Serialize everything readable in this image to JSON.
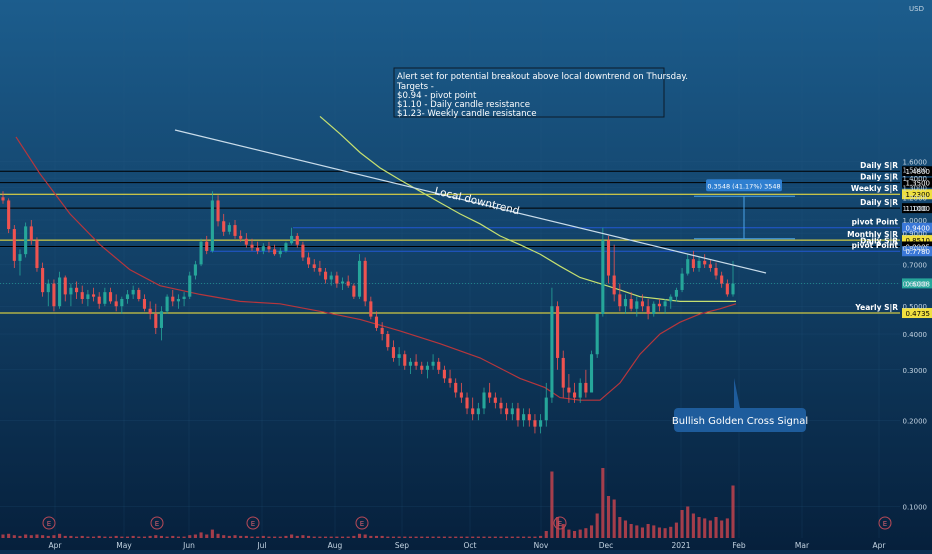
{
  "colors": {
    "bg_top": "#1c5d8d",
    "bg_bottom": "#06203c",
    "up": "#26a69a",
    "down": "#ef5350",
    "yellow_line": "#ffeb3b",
    "black_line": "#000000",
    "blue_line": "#2962ff",
    "ma_green": "#c6e070",
    "ma_red": "#b7363c",
    "trendline": "#c9dcea",
    "axis_text": "#c4d4e2",
    "volume": "#d9474f",
    "callout_bg": "#1e5c9c"
  },
  "chart_data": {
    "type": "candlestick",
    "currency": "USD",
    "y_axis": {
      "scale": "log",
      "ylim": [
        0.073,
        2.15
      ],
      "ticks": [
        "1.6000",
        "1.5000",
        "1.4000",
        "1.3000",
        "1.2000",
        "1.1000",
        "1.0000",
        "0.9000",
        "0.8000",
        "0.7000",
        "0.6000",
        "0.5000",
        "0.4000",
        "0.3000",
        "0.2000",
        "0.1000"
      ]
    },
    "x_axis": {
      "labels": [
        "Apr",
        "May",
        "Jun",
        "Jul",
        "Aug",
        "Sep",
        "Oct",
        "Nov",
        "Dec",
        "2021",
        "Feb",
        "Mar",
        "Apr"
      ]
    },
    "annotation_box": {
      "lines": [
        "Alert set for potential breakout above local downtrend on Thursday.",
        "Targets -",
        "$0.94 - pivot point",
        "$1.10 - Daily candle resistance",
        "$1.23- Weekly candle resistance"
      ]
    },
    "horizontal_levels": [
      {
        "label": "Daily S|R",
        "price": "1.4800",
        "value": 1.48,
        "style": "black"
      },
      {
        "label": "Daily S|R",
        "price": "1.3500",
        "value": 1.35,
        "style": "black"
      },
      {
        "label": "Weekly S|R",
        "price": "1.2300",
        "value": 1.23,
        "style": "yellow"
      },
      {
        "label": "Daily S|R",
        "price": "1.1000",
        "value": 1.1,
        "style": "black"
      },
      {
        "label": "pivot Point",
        "price": "0.9400",
        "value": 0.94,
        "style": "blue"
      },
      {
        "label": "Monthly S|R",
        "price": "0.8510",
        "value": 0.851,
        "style": "yellow"
      },
      {
        "label": "Daily S|R",
        "price": "0.8085",
        "value": 0.8085,
        "style": "black"
      },
      {
        "label": "pivot Point",
        "price": "0.7780",
        "value": 0.778,
        "style": "blue"
      },
      {
        "label": "Yearly S|R",
        "price": "0.4735",
        "value": 0.4735,
        "style": "yellow"
      }
    ],
    "current_price": {
      "price": "0.6008",
      "value": 0.6008
    },
    "trendline_label": "Local downtrend",
    "measure_label": "0.3548 (41.17%) 3548",
    "signal_label": "Bullish Golden Cross Signal",
    "earnings_marker": "E",
    "candles": [
      [
        1.2,
        1.26,
        1.14,
        1.17
      ],
      [
        1.17,
        1.19,
        0.9,
        0.93
      ],
      [
        0.93,
        0.96,
        0.68,
        0.72
      ],
      [
        0.72,
        0.79,
        0.64,
        0.76
      ],
      [
        0.76,
        0.98,
        0.74,
        0.95
      ],
      [
        0.95,
        1.0,
        0.82,
        0.85
      ],
      [
        0.85,
        0.87,
        0.66,
        0.68
      ],
      [
        0.68,
        0.71,
        0.54,
        0.56
      ],
      [
        0.56,
        0.62,
        0.5,
        0.6
      ],
      [
        0.6,
        0.62,
        0.48,
        0.5
      ],
      [
        0.5,
        0.66,
        0.49,
        0.63
      ],
      [
        0.63,
        0.64,
        0.52,
        0.55
      ],
      [
        0.55,
        0.6,
        0.5,
        0.58
      ],
      [
        0.58,
        0.61,
        0.53,
        0.56
      ],
      [
        0.56,
        0.59,
        0.51,
        0.53
      ],
      [
        0.53,
        0.57,
        0.5,
        0.55
      ],
      [
        0.55,
        0.58,
        0.52,
        0.54
      ],
      [
        0.54,
        0.56,
        0.49,
        0.51
      ],
      [
        0.51,
        0.58,
        0.5,
        0.56
      ],
      [
        0.56,
        0.58,
        0.51,
        0.52
      ],
      [
        0.52,
        0.55,
        0.48,
        0.5
      ],
      [
        0.5,
        0.54,
        0.47,
        0.53
      ],
      [
        0.53,
        0.57,
        0.51,
        0.55
      ],
      [
        0.55,
        0.59,
        0.53,
        0.57
      ],
      [
        0.57,
        0.58,
        0.52,
        0.53
      ],
      [
        0.53,
        0.55,
        0.48,
        0.49
      ],
      [
        0.49,
        0.52,
        0.45,
        0.47
      ],
      [
        0.47,
        0.51,
        0.4,
        0.42
      ],
      [
        0.42,
        0.5,
        0.38,
        0.48
      ],
      [
        0.48,
        0.55,
        0.47,
        0.54
      ],
      [
        0.54,
        0.57,
        0.5,
        0.52
      ],
      [
        0.52,
        0.55,
        0.49,
        0.53
      ],
      [
        0.53,
        0.56,
        0.5,
        0.54
      ],
      [
        0.54,
        0.66,
        0.53,
        0.64
      ],
      [
        0.64,
        0.72,
        0.62,
        0.7
      ],
      [
        0.7,
        0.86,
        0.69,
        0.84
      ],
      [
        0.84,
        0.88,
        0.76,
        0.78
      ],
      [
        0.78,
        1.26,
        0.77,
        1.17
      ],
      [
        1.17,
        1.22,
        0.95,
        0.99
      ],
      [
        0.99,
        1.05,
        0.88,
        0.91
      ],
      [
        0.91,
        0.98,
        0.89,
        0.96
      ],
      [
        0.96,
        1.0,
        0.86,
        0.88
      ],
      [
        0.88,
        0.92,
        0.84,
        0.86
      ],
      [
        0.86,
        0.9,
        0.8,
        0.82
      ],
      [
        0.82,
        0.86,
        0.78,
        0.8
      ],
      [
        0.8,
        0.84,
        0.76,
        0.78
      ],
      [
        0.78,
        0.83,
        0.76,
        0.81
      ],
      [
        0.81,
        0.84,
        0.77,
        0.79
      ],
      [
        0.79,
        0.82,
        0.75,
        0.76
      ],
      [
        0.76,
        0.8,
        0.74,
        0.78
      ],
      [
        0.78,
        0.84,
        0.77,
        0.83
      ],
      [
        0.83,
        0.94,
        0.82,
        0.88
      ],
      [
        0.88,
        0.9,
        0.8,
        0.82
      ],
      [
        0.82,
        0.84,
        0.72,
        0.74
      ],
      [
        0.74,
        0.77,
        0.68,
        0.7
      ],
      [
        0.7,
        0.73,
        0.66,
        0.68
      ],
      [
        0.68,
        0.72,
        0.64,
        0.66
      ],
      [
        0.66,
        0.68,
        0.6,
        0.62
      ],
      [
        0.62,
        0.66,
        0.59,
        0.64
      ],
      [
        0.64,
        0.66,
        0.58,
        0.6
      ],
      [
        0.6,
        0.63,
        0.57,
        0.61
      ],
      [
        0.61,
        0.64,
        0.58,
        0.59
      ],
      [
        0.59,
        0.6,
        0.53,
        0.54
      ],
      [
        0.54,
        0.76,
        0.53,
        0.72
      ],
      [
        0.72,
        0.74,
        0.5,
        0.52
      ],
      [
        0.52,
        0.54,
        0.45,
        0.46
      ],
      [
        0.46,
        0.48,
        0.41,
        0.42
      ],
      [
        0.42,
        0.44,
        0.38,
        0.4
      ],
      [
        0.4,
        0.41,
        0.35,
        0.36
      ],
      [
        0.36,
        0.38,
        0.32,
        0.33
      ],
      [
        0.33,
        0.36,
        0.31,
        0.34
      ],
      [
        0.34,
        0.35,
        0.3,
        0.31
      ],
      [
        0.31,
        0.33,
        0.29,
        0.32
      ],
      [
        0.32,
        0.34,
        0.3,
        0.31
      ],
      [
        0.31,
        0.32,
        0.29,
        0.3
      ],
      [
        0.3,
        0.32,
        0.28,
        0.31
      ],
      [
        0.31,
        0.34,
        0.3,
        0.32
      ],
      [
        0.32,
        0.33,
        0.29,
        0.3
      ],
      [
        0.3,
        0.31,
        0.27,
        0.28
      ],
      [
        0.28,
        0.3,
        0.26,
        0.27
      ],
      [
        0.27,
        0.28,
        0.24,
        0.25
      ],
      [
        0.25,
        0.27,
        0.23,
        0.24
      ],
      [
        0.24,
        0.25,
        0.21,
        0.22
      ],
      [
        0.22,
        0.24,
        0.2,
        0.21
      ],
      [
        0.21,
        0.23,
        0.2,
        0.22
      ],
      [
        0.22,
        0.26,
        0.21,
        0.25
      ],
      [
        0.25,
        0.27,
        0.23,
        0.24
      ],
      [
        0.24,
        0.25,
        0.22,
        0.23
      ],
      [
        0.23,
        0.24,
        0.21,
        0.22
      ],
      [
        0.22,
        0.23,
        0.2,
        0.21
      ],
      [
        0.21,
        0.23,
        0.2,
        0.22
      ],
      [
        0.22,
        0.23,
        0.19,
        0.2
      ],
      [
        0.2,
        0.22,
        0.19,
        0.21
      ],
      [
        0.21,
        0.22,
        0.19,
        0.2
      ],
      [
        0.2,
        0.21,
        0.18,
        0.19
      ],
      [
        0.19,
        0.21,
        0.18,
        0.2
      ],
      [
        0.2,
        0.27,
        0.19,
        0.24
      ],
      [
        0.24,
        0.58,
        0.23,
        0.5
      ],
      [
        0.5,
        0.52,
        0.3,
        0.33
      ],
      [
        0.33,
        0.35,
        0.24,
        0.26
      ],
      [
        0.26,
        0.29,
        0.23,
        0.25
      ],
      [
        0.25,
        0.27,
        0.23,
        0.24
      ],
      [
        0.24,
        0.28,
        0.23,
        0.27
      ],
      [
        0.27,
        0.3,
        0.24,
        0.25
      ],
      [
        0.25,
        0.35,
        0.25,
        0.34
      ],
      [
        0.34,
        0.44,
        0.33,
        0.47
      ],
      [
        0.47,
        0.94,
        0.46,
        0.85
      ],
      [
        0.85,
        0.88,
        0.6,
        0.64
      ],
      [
        0.64,
        0.82,
        0.52,
        0.55
      ],
      [
        0.55,
        0.6,
        0.48,
        0.5
      ],
      [
        0.5,
        0.55,
        0.47,
        0.53
      ],
      [
        0.53,
        0.56,
        0.48,
        0.49
      ],
      [
        0.49,
        0.54,
        0.46,
        0.52
      ],
      [
        0.52,
        0.55,
        0.48,
        0.5
      ],
      [
        0.5,
        0.53,
        0.45,
        0.47
      ],
      [
        0.47,
        0.52,
        0.46,
        0.51
      ],
      [
        0.51,
        0.53,
        0.48,
        0.5
      ],
      [
        0.5,
        0.53,
        0.47,
        0.52
      ],
      [
        0.52,
        0.55,
        0.49,
        0.54
      ],
      [
        0.54,
        0.58,
        0.52,
        0.57
      ],
      [
        0.57,
        0.68,
        0.56,
        0.65
      ],
      [
        0.65,
        0.76,
        0.64,
        0.73
      ],
      [
        0.73,
        0.78,
        0.66,
        0.68
      ],
      [
        0.68,
        0.74,
        0.66,
        0.72
      ],
      [
        0.72,
        0.76,
        0.68,
        0.7
      ],
      [
        0.7,
        0.73,
        0.66,
        0.68
      ],
      [
        0.68,
        0.71,
        0.62,
        0.64
      ],
      [
        0.64,
        0.66,
        0.58,
        0.6
      ],
      [
        0.6,
        0.62,
        0.54,
        0.55
      ],
      [
        0.55,
        0.72,
        0.54,
        0.6
      ]
    ],
    "volume": [
      0.05,
      0.06,
      0.04,
      0.03,
      0.05,
      0.04,
      0.05,
      0.04,
      0.03,
      0.04,
      0.06,
      0.03,
      0.03,
      0.02,
      0.03,
      0.02,
      0.02,
      0.03,
      0.02,
      0.02,
      0.03,
      0.02,
      0.02,
      0.03,
      0.02,
      0.02,
      0.03,
      0.04,
      0.03,
      0.02,
      0.03,
      0.02,
      0.02,
      0.04,
      0.05,
      0.08,
      0.05,
      0.12,
      0.06,
      0.04,
      0.03,
      0.04,
      0.03,
      0.03,
      0.02,
      0.02,
      0.03,
      0.02,
      0.02,
      0.02,
      0.03,
      0.05,
      0.03,
      0.04,
      0.03,
      0.02,
      0.02,
      0.02,
      0.02,
      0.02,
      0.02,
      0.02,
      0.03,
      0.06,
      0.05,
      0.03,
      0.03,
      0.03,
      0.02,
      0.02,
      0.02,
      0.02,
      0.02,
      0.02,
      0.02,
      0.02,
      0.02,
      0.02,
      0.02,
      0.02,
      0.02,
      0.02,
      0.02,
      0.02,
      0.02,
      0.02,
      0.02,
      0.02,
      0.02,
      0.02,
      0.02,
      0.02,
      0.02,
      0.02,
      0.02,
      0.03,
      0.1,
      0.95,
      0.3,
      0.2,
      0.12,
      0.1,
      0.12,
      0.14,
      0.18,
      0.35,
      1.0,
      0.6,
      0.55,
      0.3,
      0.25,
      0.2,
      0.18,
      0.15,
      0.2,
      0.18,
      0.15,
      0.14,
      0.16,
      0.22,
      0.4,
      0.45,
      0.35,
      0.3,
      0.28,
      0.25,
      0.3,
      0.25,
      0.28,
      0.75
    ],
    "ma_long": [
      [
        16,
        1.95
      ],
      [
        40,
        1.45
      ],
      [
        70,
        1.05
      ],
      [
        100,
        0.82
      ],
      [
        130,
        0.67
      ],
      [
        160,
        0.59
      ],
      [
        200,
        0.55
      ],
      [
        240,
        0.52
      ],
      [
        280,
        0.51
      ],
      [
        320,
        0.48
      ],
      [
        360,
        0.45
      ],
      [
        400,
        0.41
      ],
      [
        440,
        0.37
      ],
      [
        480,
        0.33
      ],
      [
        520,
        0.28
      ],
      [
        545,
        0.26
      ],
      [
        560,
        0.24
      ],
      [
        580,
        0.235
      ],
      [
        600,
        0.235
      ],
      [
        620,
        0.27
      ],
      [
        640,
        0.34
      ],
      [
        660,
        0.4
      ],
      [
        680,
        0.44
      ],
      [
        700,
        0.47
      ],
      [
        720,
        0.49
      ],
      [
        736,
        0.51
      ]
    ],
    "ma_short": [
      [
        320,
        2.3
      ],
      [
        340,
        2.0
      ],
      [
        360,
        1.72
      ],
      [
        380,
        1.52
      ],
      [
        400,
        1.38
      ],
      [
        420,
        1.26
      ],
      [
        440,
        1.15
      ],
      [
        460,
        1.05
      ],
      [
        480,
        0.97
      ],
      [
        500,
        0.88
      ],
      [
        520,
        0.82
      ],
      [
        540,
        0.76
      ],
      [
        560,
        0.69
      ],
      [
        580,
        0.63
      ],
      [
        600,
        0.6
      ],
      [
        620,
        0.57
      ],
      [
        640,
        0.54
      ],
      [
        660,
        0.53
      ],
      [
        680,
        0.52
      ],
      [
        700,
        0.52
      ],
      [
        720,
        0.52
      ],
      [
        736,
        0.52
      ]
    ]
  }
}
